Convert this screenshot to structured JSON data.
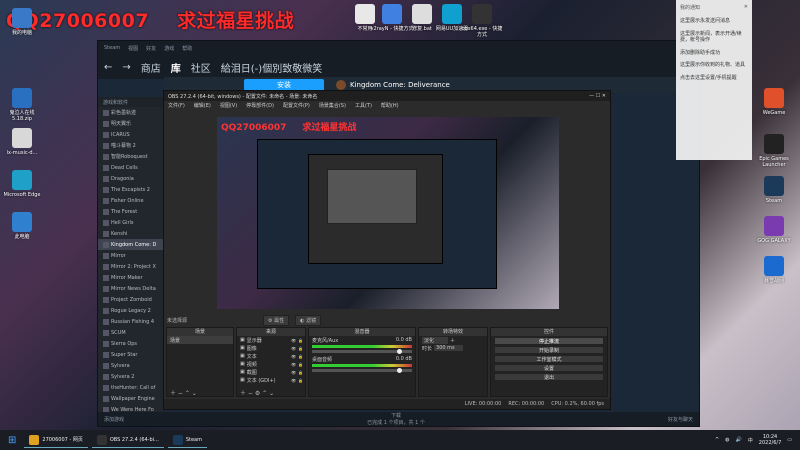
{
  "overlay": {
    "qq": "QQ27006007",
    "slogan": "求过福星挑战"
  },
  "desktop_left": [
    {
      "label": "我的电脑",
      "color": "#3a78c8"
    },
    {
      "label": "鬼泣人在线 5.18.zip",
      "color": "#2a70c0"
    },
    {
      "label": "lx-music-d...",
      "color": "#d8d8d8"
    },
    {
      "label": "Microsoft Edge",
      "color": "#1fa0c8"
    },
    {
      "label": "此电脑",
      "color": "#3080d0"
    }
  ],
  "desktop_top": [
    {
      "label": "不常用",
      "color": "#e8e8e8"
    },
    {
      "label": "v2rayN - 快捷方式",
      "color": "#4080e0"
    },
    {
      "label": "修复.bat",
      "color": "#dddddd"
    },
    {
      "label": "网易UU加速器",
      "color": "#10a0d0"
    },
    {
      "label": "obs64.exe - 快捷方式",
      "color": "#333333"
    }
  ],
  "desktop_right": [
    {
      "label": "WeGame",
      "color": "#e0502a"
    },
    {
      "label": "Epic Games Launcher",
      "color": "#222222"
    },
    {
      "label": "Steam",
      "color": "#1b3a5a"
    },
    {
      "label": "GOG GALAXY",
      "color": "#7a3ab0"
    },
    {
      "label": "暴雪战网",
      "color": "#1a6ad0"
    }
  ],
  "steam": {
    "top_menu": [
      "Steam",
      "视图",
      "好友",
      "游戏",
      "帮助"
    ],
    "nav": [
      "商店",
      "库",
      "社区",
      "給泪日(-)個別致敬微笑"
    ],
    "sidebar_header": "游戏和软件",
    "games": [
      "彩色墨轨迹",
      "明天翼乐",
      "ICARUS",
      "喵斗幕物 2",
      "智能Roboquest",
      "Dead Cells",
      "Dragonia",
      "The Escapists 2",
      "Fisher Online",
      "The Forest",
      "Hell Girls",
      "Kenshi",
      "Kingdom Come: D",
      "Mirror",
      "Mirror 2: Project X",
      "Mirror Maker",
      "Mirror News Delta",
      "Project Zomboid",
      "Rogue Legacy 2",
      "Russian Fishing 4",
      "SCUM",
      "Sierra Ops",
      "Super Star",
      "Sylvera",
      "Sylvera 2",
      "theHunter: Call of",
      "Wallpaper Engine",
      "We Were Here Fo"
    ],
    "selected_game": "Kingdom Come: D",
    "install_label": "安装",
    "game_name": "Kingdom Come: Deliverance",
    "add_game": "添加游戏",
    "downloads": "下载",
    "downloads_sub": "已完成 1 个项目，共 1 个",
    "friends": "好友与聊天"
  },
  "obs": {
    "title": "OBS 27.2.4 (64-bit, windows) - 配置文件: 未命名 - 场景: 未命名",
    "menu": [
      "文件(F)",
      "编辑(E)",
      "视图(V)",
      "停靠部件(D)",
      "配置文件(P)",
      "场景集合(S)",
      "工具(T)",
      "帮助(H)"
    ],
    "no_source": "未选择源",
    "props": "属性",
    "filters": "滤镜",
    "docks": {
      "scenes": "场景",
      "sources": "来源",
      "mixer": "混音器",
      "transitions": "转场特效",
      "controls": "控件"
    },
    "scenes": [
      "场景"
    ],
    "sources": [
      "显示器",
      "图像",
      "文本",
      "视频",
      "截图",
      "文本 (GDI+)"
    ],
    "mixer": [
      {
        "name": "麦克风/Aux",
        "db": "0.0 dB"
      },
      {
        "name": "桌面音频",
        "db": "0.0 dB"
      }
    ],
    "transition": {
      "type": "淡化",
      "duration_label": "时长",
      "duration": "300 ms"
    },
    "controls": [
      "停止推流",
      "开始录制",
      "工作室模式",
      "设置",
      "退出"
    ],
    "status": {
      "live": "LIVE: 00:00:00",
      "rec": "REC: 00:00:00",
      "cpu": "CPU: 0.2%, 60.00 fps"
    }
  },
  "notifications": {
    "header": "我的通知",
    "items": [
      "这里展示永发送问消息",
      "这里展示新闻，表示开通/续费，帐号操作",
      "添加删除助手成功",
      "这里展示你收到的礼物、道具",
      "点击去这里设置/手机提醒"
    ]
  },
  "taskbar": {
    "items": [
      {
        "label": "27006007 - 网页",
        "color": "#e0a020"
      },
      {
        "label": "OBS 27.2.4 (64-bi...",
        "color": "#333333"
      },
      {
        "label": "Steam",
        "color": "#1b3a5a"
      }
    ],
    "time": "10:24",
    "date": "2022/6/7",
    "lang": "中"
  }
}
